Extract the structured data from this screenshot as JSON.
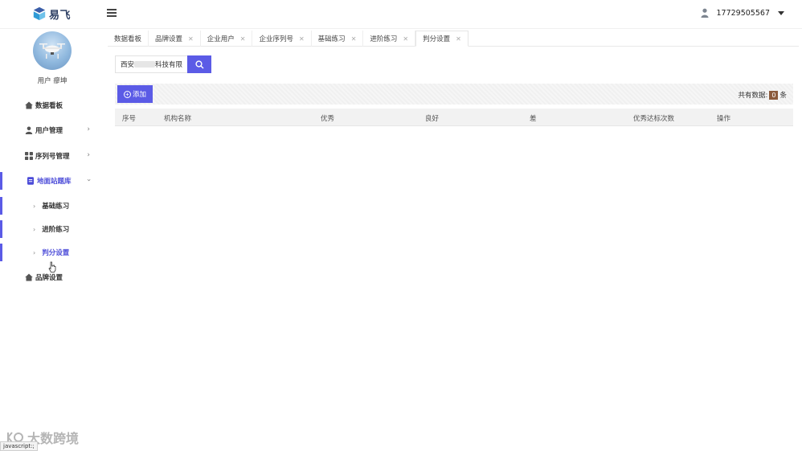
{
  "app": {
    "logo_text": "易飞"
  },
  "header": {
    "user_phone": "17729505567"
  },
  "sidebar": {
    "username": "用户 瘳坤",
    "items": [
      {
        "label": "数据看板",
        "icon": "home-icon"
      },
      {
        "label": "用户管理",
        "icon": "user-icon"
      },
      {
        "label": "序列号管理",
        "icon": "grid-icon"
      },
      {
        "label": "地面站题库",
        "icon": "document-icon"
      },
      {
        "label": "品牌设置",
        "icon": "home-icon"
      }
    ],
    "sub_items": [
      {
        "label": "基础练习"
      },
      {
        "label": "进阶练习"
      },
      {
        "label": "判分设置"
      }
    ]
  },
  "tabs": [
    {
      "label": "数据看板"
    },
    {
      "label": "品牌设置"
    },
    {
      "label": "企业用户"
    },
    {
      "label": "企业序列号"
    },
    {
      "label": "基础练习"
    },
    {
      "label": "进阶练习"
    },
    {
      "label": "判分设置"
    }
  ],
  "search": {
    "prefix": "西安",
    "suffix": "科技有限"
  },
  "toolbar": {
    "add_label": "添加",
    "count_prefix": "共有数据:",
    "count_value": "0",
    "count_suffix": "条"
  },
  "table": {
    "headers": [
      "序号",
      "机构名称",
      "优秀",
      "良好",
      "差",
      "优秀达标次数",
      "操作"
    ]
  },
  "statusbar": {
    "text": "javascript:;"
  },
  "watermark": {
    "text": "大数跨境"
  },
  "colors": {
    "accent": "#5b5be6",
    "count_badge": "#8b5a3c"
  }
}
